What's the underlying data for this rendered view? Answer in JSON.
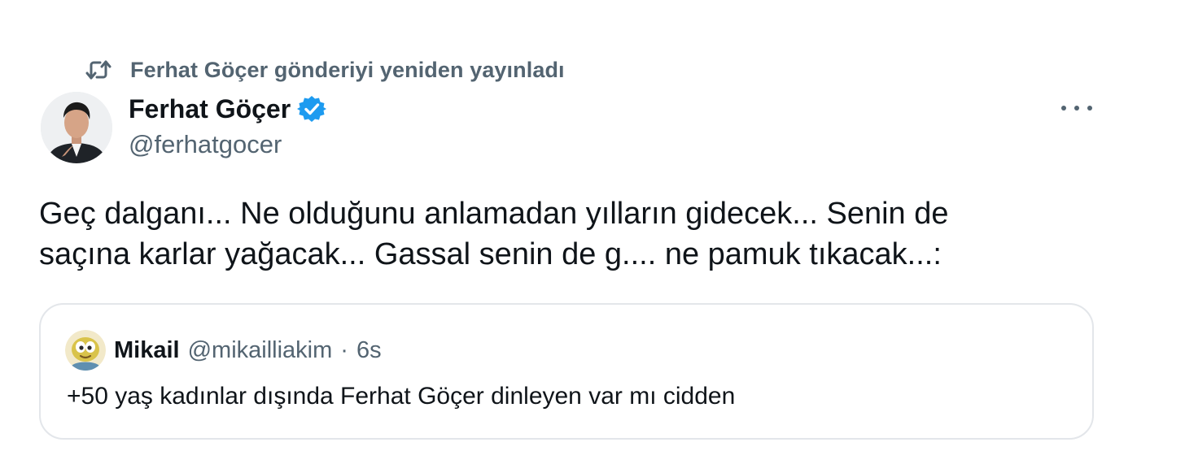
{
  "repost": {
    "icon": "repost-icon",
    "text": "Ferhat Göçer gönderiyi yeniden yayınladı"
  },
  "author": {
    "name": "Ferhat Göçer",
    "handle": "@ferhatgocer",
    "verified": true,
    "verified_color": "#1d9bf0"
  },
  "more_icon": "more-horizontal-icon",
  "tweet": {
    "text_line1": "Geç dalganı... Ne olduğunu anlamadan yılların gidecek... Senin de",
    "text_line2": "saçına karlar yağacak... Gassal senin de g.... ne pamuk tıkacak...:"
  },
  "quote": {
    "name": "Mikail",
    "handle": "@mikailliakim",
    "separator": "·",
    "time": "6s",
    "text": "+50 yaş kadınlar dışında Ferhat Göçer dinleyen var mı cidden"
  },
  "colors": {
    "text_primary": "#0f1419",
    "text_secondary": "#536471",
    "border": "#e3e6ea",
    "accent": "#1d9bf0"
  }
}
